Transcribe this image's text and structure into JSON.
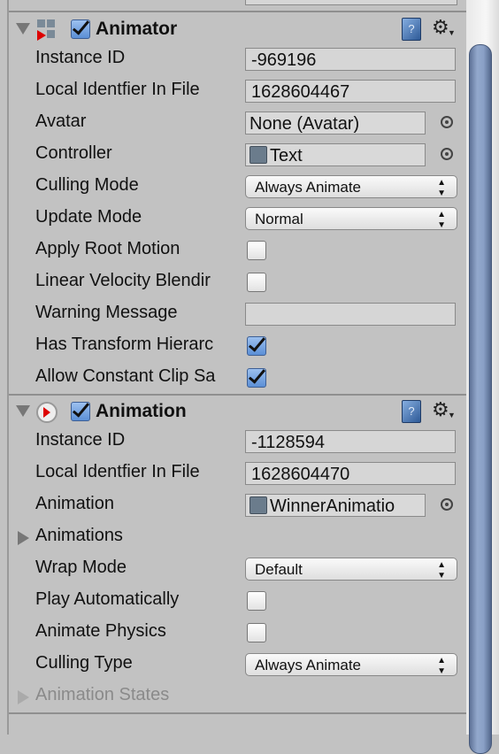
{
  "components": [
    {
      "title": "Animator",
      "icon": "animator-icon",
      "enabled": true,
      "help_label": "?",
      "rows": [
        {
          "label": "Instance ID",
          "type": "text",
          "value": "-969196"
        },
        {
          "label": "Local Identfier In File",
          "type": "text",
          "value": "1628604467"
        },
        {
          "label": "Avatar",
          "type": "object",
          "value": "None (Avatar)",
          "icon": false
        },
        {
          "label": "Controller",
          "type": "object",
          "value": "Text",
          "icon": true
        },
        {
          "label": "Culling Mode",
          "type": "dropdown",
          "value": "Always Animate"
        },
        {
          "label": "Update Mode",
          "type": "dropdown",
          "value": "Normal"
        },
        {
          "label": "Apply Root Motion",
          "type": "checkbox",
          "checked": false
        },
        {
          "label": "Linear Velocity Blendir",
          "type": "checkbox",
          "checked": false
        },
        {
          "label": "Warning Message",
          "type": "text",
          "value": ""
        },
        {
          "label": "Has Transform Hierarc",
          "type": "checkbox",
          "checked": true
        },
        {
          "label": "Allow Constant Clip Sa",
          "type": "checkbox",
          "checked": true
        }
      ]
    },
    {
      "title": "Animation",
      "icon": "animation-icon",
      "enabled": true,
      "help_label": "?",
      "rows": [
        {
          "label": "Instance ID",
          "type": "text",
          "value": "-1128594"
        },
        {
          "label": "Local Identfier In File",
          "type": "text",
          "value": "1628604470"
        },
        {
          "label": "Animation",
          "type": "object",
          "value": "WinnerAnimatio",
          "icon": true
        },
        {
          "label": "Animations",
          "type": "foldout"
        },
        {
          "label": "Wrap Mode",
          "type": "dropdown",
          "value": "Default"
        },
        {
          "label": "Play Automatically",
          "type": "checkbox",
          "checked": false
        },
        {
          "label": "Animate Physics",
          "type": "checkbox",
          "checked": false
        },
        {
          "label": "Culling Type",
          "type": "dropdown",
          "value": "Always Animate"
        },
        {
          "label": "Animation States",
          "type": "foldout",
          "disabled": true
        }
      ]
    }
  ],
  "colors": {
    "background": "#c2c2c2",
    "scrollbar_thumb": "#8aa0c6",
    "checkbox_on": "#5b8fd6"
  }
}
